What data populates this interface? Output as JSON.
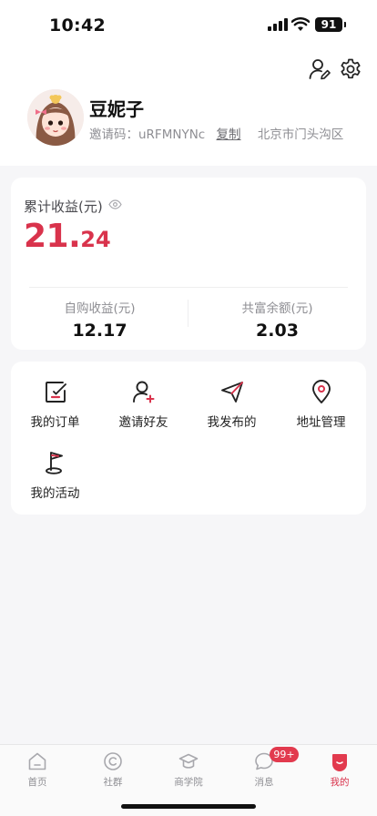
{
  "status_bar": {
    "time": "10:42",
    "battery": "91"
  },
  "header": {
    "icons": [
      "user-edit-icon",
      "gear-icon"
    ]
  },
  "profile": {
    "nickname": "豆妮子",
    "invite_label": "邀请码：",
    "invite_code": "uRFMNYNc",
    "copy_label": "复制",
    "location": "北京市门头沟区"
  },
  "earnings": {
    "title": "累计收益(元)",
    "total_int": "21.",
    "total_dec": "24",
    "self_label": "自购收益(元)",
    "self_value": "12.17",
    "shared_label": "共富余额(元)",
    "shared_value": "2.03"
  },
  "menu": {
    "items": [
      {
        "label": "我的订单",
        "icon": "order-icon"
      },
      {
        "label": "邀请好友",
        "icon": "add-friend-icon"
      },
      {
        "label": "我发布的",
        "icon": "send-icon"
      },
      {
        "label": "地址管理",
        "icon": "location-pin-icon"
      },
      {
        "label": "我的活动",
        "icon": "activity-flag-icon"
      }
    ]
  },
  "tab_bar": {
    "tabs": [
      {
        "label": "首页",
        "icon": "home-icon"
      },
      {
        "label": "社群",
        "icon": "community-icon"
      },
      {
        "label": "商学院",
        "icon": "graduation-cap-icon"
      },
      {
        "label": "消息",
        "icon": "message-icon"
      },
      {
        "label": "我的",
        "icon": "profile-tab-icon"
      }
    ],
    "message_badge": "99+",
    "active_color": "#d9334c"
  },
  "colors": {
    "accent": "#d9334c",
    "background": "#f6f6f8"
  }
}
